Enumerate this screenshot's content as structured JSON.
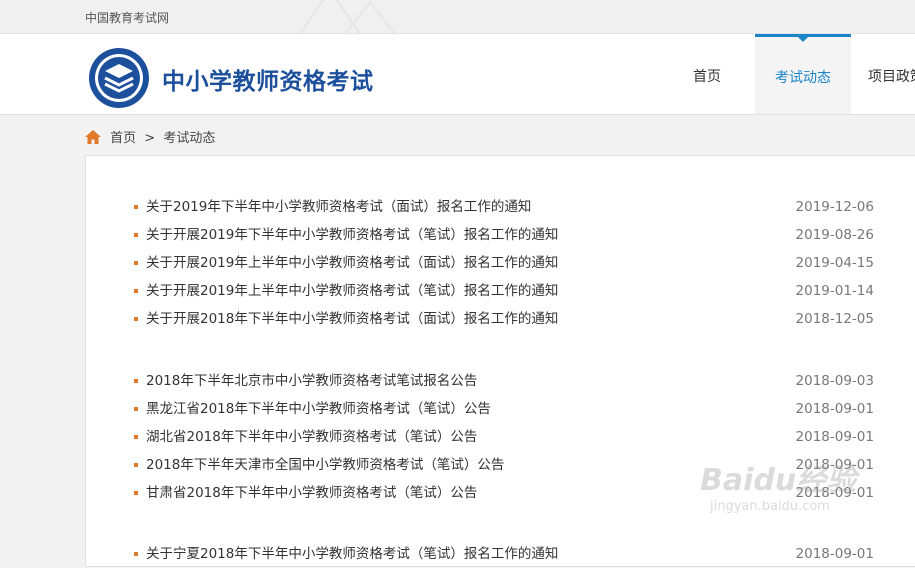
{
  "topbar": {
    "site_name": "中国教育考试网"
  },
  "header": {
    "brand": "中小学教师资格考试",
    "nav": [
      {
        "label": "首页"
      },
      {
        "label": "考试动态"
      },
      {
        "label": "项目政策"
      }
    ],
    "active_color": "#1a86c8"
  },
  "breadcrumb": {
    "home": "首页",
    "separator": ">",
    "current": "考试动态"
  },
  "groups": [
    {
      "items": [
        {
          "title": "关于2019年下半年中小学教师资格考试（面试）报名工作的通知",
          "date": "2019-12-06"
        },
        {
          "title": "关于开展2019年下半年中小学教师资格考试（笔试）报名工作的通知",
          "date": "2019-08-26"
        },
        {
          "title": "关于开展2019年上半年中小学教师资格考试（面试）报名工作的通知",
          "date": "2019-04-15"
        },
        {
          "title": "关于开展2019年上半年中小学教师资格考试（笔试）报名工作的通知",
          "date": "2019-01-14"
        },
        {
          "title": "关于开展2018年下半年中小学教师资格考试（面试）报名工作的通知",
          "date": "2018-12-05"
        }
      ]
    },
    {
      "items": [
        {
          "title": "2018年下半年北京市中小学教师资格考试笔试报名公告",
          "date": "2018-09-03"
        },
        {
          "title": "黑龙江省2018年下半年中小学教师资格考试（笔试）公告",
          "date": "2018-09-01"
        },
        {
          "title": "湖北省2018年下半年中小学教师资格考试（笔试）公告",
          "date": "2018-09-01"
        },
        {
          "title": "2018年下半年天津市全国中小学教师资格考试（笔试）公告",
          "date": "2018-09-01"
        },
        {
          "title": "甘肃省2018年下半年中小学教师资格考试（笔试）公告",
          "date": "2018-09-01"
        }
      ]
    },
    {
      "items": [
        {
          "title": "关于宁夏2018年下半年中小学教师资格考试（笔试）报名工作的通知",
          "date": "2018-09-01"
        }
      ]
    }
  ],
  "watermark": {
    "brand": "Baidu经验",
    "url": "jingyan.baidu.com"
  },
  "colors": {
    "bullet": "#e07a2a",
    "brand_text": "#1c4f9c"
  }
}
